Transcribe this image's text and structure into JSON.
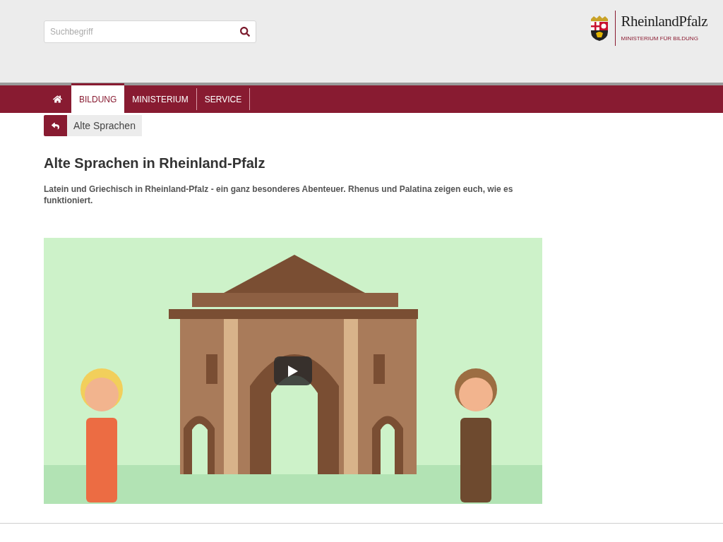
{
  "search": {
    "placeholder": "Suchbegriff"
  },
  "logo": {
    "name": "RheinlandPfalz",
    "subtitle": "MINISTERIUM FÜR BILDUNG"
  },
  "nav": {
    "items": [
      {
        "label": "BILDUNG",
        "selected": true
      },
      {
        "label": "MINISTERIUM",
        "selected": false
      },
      {
        "label": "SERVICE",
        "selected": false
      }
    ]
  },
  "breadcrumb": {
    "label": "Alte Sprachen"
  },
  "title": "Alte Sprachen in Rheinland-Pfalz",
  "intro": "Latein und Griechisch in Rheinland-Pfalz - ein ganz besonderes Abenteuer. Rhenus und Palatina zeigen euch, wie es funktioniert."
}
